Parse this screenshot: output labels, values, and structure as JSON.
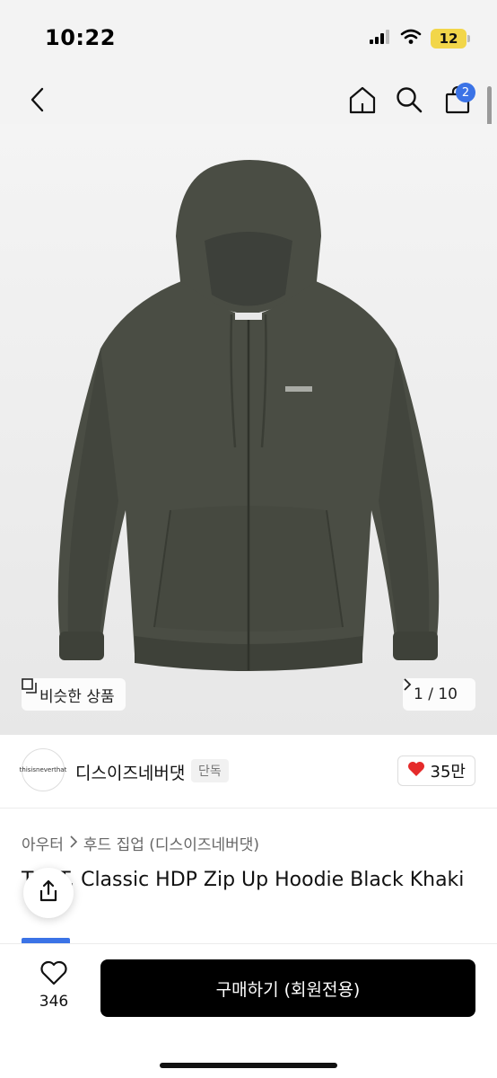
{
  "status_bar": {
    "time": "10:22",
    "battery": "12"
  },
  "nav": {
    "cart_count": "2"
  },
  "gallery": {
    "similar_label": "비슷한 상품",
    "pager": "1 / 10"
  },
  "brand": {
    "logo_text": "thisisneverthat",
    "name": "디스이즈네버댓",
    "badge": "단독",
    "likes": "35만",
    "heart_color": "#e52b2b"
  },
  "product": {
    "breadcrumb": [
      "아우터",
      "후드 집업 (디스이즈네버댓)"
    ],
    "title": "T.N.T. Classic HDP Zip Up Hoodie Black Khaki"
  },
  "bottom_bar": {
    "wish_count": "346",
    "buy_label": "구매하기 (회원전용)"
  },
  "colors": {
    "accent": "#3b73e6",
    "hoodie": "#4a4d44"
  }
}
